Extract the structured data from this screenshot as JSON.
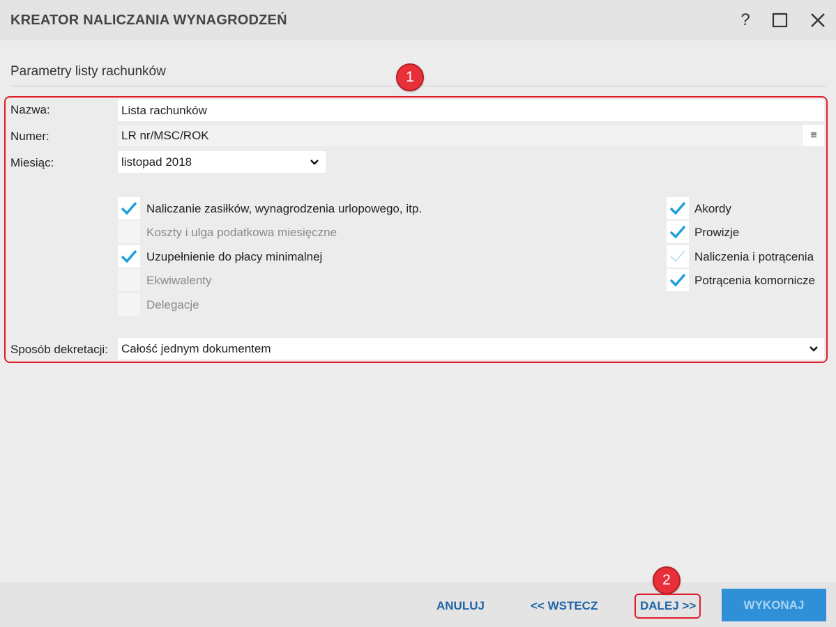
{
  "window": {
    "title": "KREATOR NALICZANIA WYNAGRODZEŃ",
    "help_label": "?"
  },
  "section": {
    "title": "Parametry listy rachunków"
  },
  "markers": {
    "first": "1",
    "second": "2"
  },
  "form": {
    "name_label": "Nazwa:",
    "name_value": "Lista rachunków",
    "number_label": "Numer:",
    "number_value": "LR nr/MSC/ROK",
    "number_menu_glyph": "≡",
    "month_label": "Miesiąc:",
    "month_value": "listopad 2018",
    "decree_label": "Sposób dekretacji:",
    "decree_value": "Całość jednym dokumentem"
  },
  "options_left": [
    {
      "label": "Naliczanie zasiłków, wynagrodzenia urlopowego, itp.",
      "checked": true,
      "enabled": true
    },
    {
      "label": "Koszty i ulga podatkowa miesięczne",
      "checked": false,
      "enabled": false
    },
    {
      "label": "Uzupełnienie do płacy minimalnej",
      "checked": true,
      "enabled": true
    },
    {
      "label": "Ekwiwalenty",
      "checked": false,
      "enabled": false
    },
    {
      "label": "Delegacje",
      "checked": false,
      "enabled": false
    }
  ],
  "options_right": [
    {
      "label": "Akordy",
      "checked": true,
      "enabled": true
    },
    {
      "label": "Prowizje",
      "checked": true,
      "enabled": true
    },
    {
      "label": "Naliczenia i potrącenia",
      "checked": "partial",
      "enabled": true
    },
    {
      "label": "Potrącenia komornicze",
      "checked": true,
      "enabled": true
    }
  ],
  "buttons": {
    "cancel": "ANULUJ",
    "back": "<< WSTECZ",
    "next": "DALEJ >>",
    "execute": "WYKONAJ"
  },
  "colors": {
    "accent": "#2f90d8",
    "link": "#1f66a6",
    "highlight": "#e11d2a",
    "check": "#1a9fd9"
  }
}
